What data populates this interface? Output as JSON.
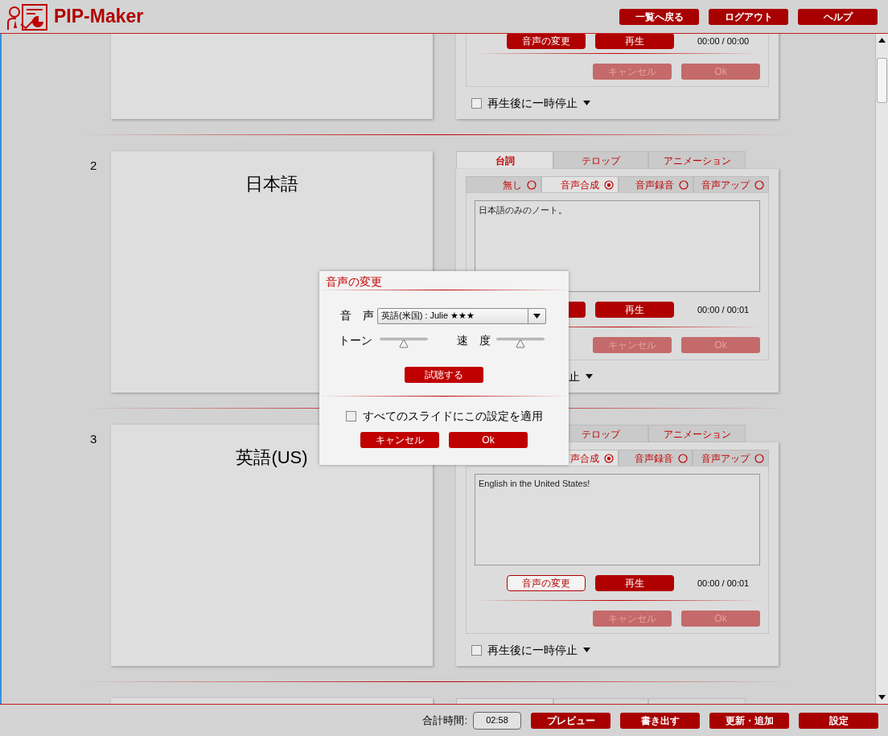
{
  "header": {
    "app_name": "PIP-Maker",
    "buttons": [
      "一覧へ戻る",
      "ログアウト",
      "ヘルプ"
    ]
  },
  "slides": [
    {
      "kind": "partial",
      "change_button": {
        "label": "音声の変更",
        "active": false
      },
      "play_button": "再生",
      "time": "00:00 / 00:00",
      "cancel_button": {
        "label": "キャンセル",
        "disabled": true
      },
      "ok_button": {
        "label": "Ok",
        "disabled": true
      },
      "pause": {
        "label": "再生後に一時停止",
        "checked": false
      }
    },
    {
      "kind": "full",
      "number": "2",
      "slide_title": "日本語",
      "tabs": [
        {
          "label": "台詞",
          "selected": true
        },
        {
          "label": "テロップ",
          "selected": false
        },
        {
          "label": "アニメーション",
          "selected": false
        }
      ],
      "audio_modes": [
        {
          "label": "無し",
          "selected": false
        },
        {
          "label": "音声合成",
          "selected": true
        },
        {
          "label": "音声録音",
          "selected": false
        },
        {
          "label": "音声アップ",
          "selected": false
        }
      ],
      "note": "日本語のみのノート。",
      "change_button": {
        "active": false
      },
      "play_button": "再生",
      "time": "00:00 / 00:01",
      "cancel_button": {
        "label": "キャンセル",
        "disabled": true
      },
      "ok_button": {
        "label": "Ok",
        "disabled": true
      },
      "pause": {
        "label": "止"
      }
    },
    {
      "kind": "full",
      "number": "3",
      "slide_title": "英語(US)",
      "tabs": [
        {
          "label": "テロップ",
          "selected": false
        },
        {
          "label": "アニメーション",
          "selected": false
        }
      ],
      "audio_modes": [
        {
          "label": "声合成",
          "selected": true
        },
        {
          "label": "音声録音",
          "selected": false
        },
        {
          "label": "音声アップ",
          "selected": false
        }
      ],
      "note": "English in the United States!",
      "change_button": {
        "label": "音声の変更",
        "active": true
      },
      "play_button": "再生",
      "time": "00:00 / 00:01",
      "cancel_button": {
        "label": "キャンセル",
        "disabled": true
      },
      "ok_button": {
        "label": "Ok",
        "disabled": true
      },
      "pause": {
        "label": "再生後に一時停止",
        "checked": false
      }
    },
    {
      "kind": "peek"
    }
  ],
  "dialog": {
    "title": "音声の変更",
    "voice_label": "音　声",
    "voice_value": "英語(米国) : Julie ★★★",
    "tone_label": "トーン",
    "tone": {
      "level": 0.5
    },
    "speed_label": "速　度",
    "speed": {
      "level": 0.5
    },
    "audition_button": "試聴する",
    "apply_all": {
      "label": "すべてのスライドにこの設定を適用",
      "checked": false
    },
    "cancel_button": "キャンセル",
    "ok_button": "Ok"
  },
  "footer": {
    "total_label": "合計時間:",
    "total_value": "02:58",
    "buttons": [
      "プレビュー",
      "書き出す",
      "更新・追加",
      "設定"
    ]
  }
}
